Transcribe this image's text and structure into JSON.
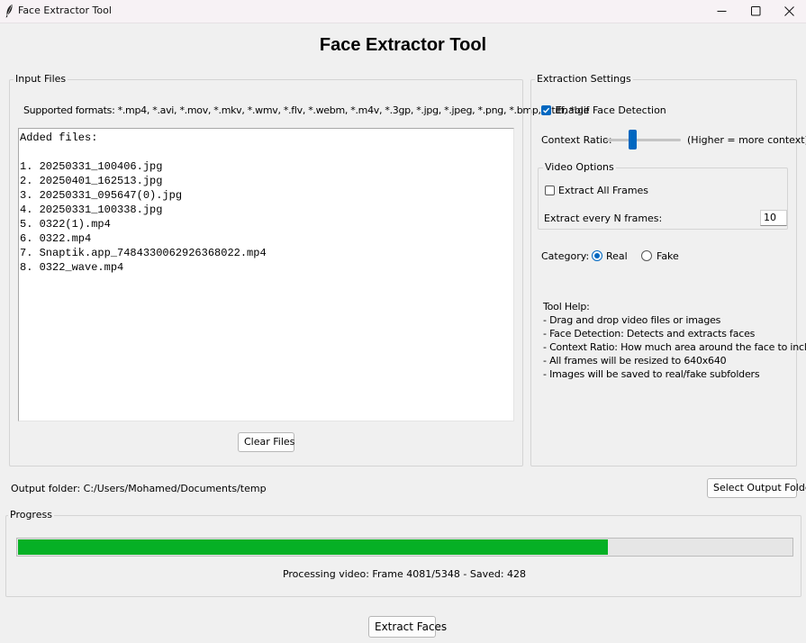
{
  "window": {
    "title": "Face Extractor Tool",
    "icon": "feather-icon",
    "controls": [
      "minimize-icon",
      "maximize-icon",
      "close-icon"
    ]
  },
  "header": {
    "title": "Face Extractor Tool"
  },
  "input_files": {
    "group_label": "Input Files",
    "supported_formats": "Supported formats: *.mp4, *.avi, *.mov, *.mkv, *.wmv, *.flv, *.webm, *.m4v, *.3gp, *.jpg, *.jpeg, *.png, *.bmp, *.tiff, *.gif",
    "list_header": "Added files:",
    "files": [
      "1. 20250331_100406.jpg",
      "2. 20250401_162513.jpg",
      "3. 20250331_095647(0).jpg",
      "4. 20250331_100338.jpg",
      "5. 0322(1).mp4",
      "6. 0322.mp4",
      "7. Snaptik.app_7484330062926368022.mp4",
      "8. 0322_wave.mp4"
    ],
    "clear_button": "Clear Files"
  },
  "settings": {
    "group_label": "Extraction Settings",
    "face_detection": {
      "label": "Enable Face Detection",
      "checked": true
    },
    "context_ratio": {
      "label": "Context Ratio:",
      "hint": "(Higher = more context)",
      "level": 0.35
    },
    "video_options": {
      "group_label": "Video Options",
      "extract_all": {
        "label": "Extract All Frames",
        "checked": false
      },
      "every_n": {
        "label": "Extract every N frames:",
        "value": "10"
      }
    },
    "category": {
      "label": "Category:",
      "options": [
        {
          "label": "Real",
          "selected": true
        },
        {
          "label": "Fake",
          "selected": false
        }
      ]
    },
    "help": {
      "title": "Tool Help:",
      "lines": [
        "- Drag and drop video files or images",
        "- Face Detection: Detects and extracts faces",
        "- Context Ratio: How much area around the face to include",
        "- All frames will be resized to 640x640",
        "- Images will be saved to real/fake subfolders"
      ]
    }
  },
  "output": {
    "label": "Output folder: C:/Users/Mohamed/Documents/temp",
    "select_button": "Select Output Folder"
  },
  "progress": {
    "group_label": "Progress",
    "fraction": 0.7625,
    "status": "Processing video: Frame 4081/5348 - Saved: 428"
  },
  "actions": {
    "extract_button": "Extract Faces"
  },
  "colors": {
    "accent": "#0067c0",
    "progress": "#06b025",
    "titlebar": "#f7f2f5",
    "background": "#f0f0f0"
  }
}
